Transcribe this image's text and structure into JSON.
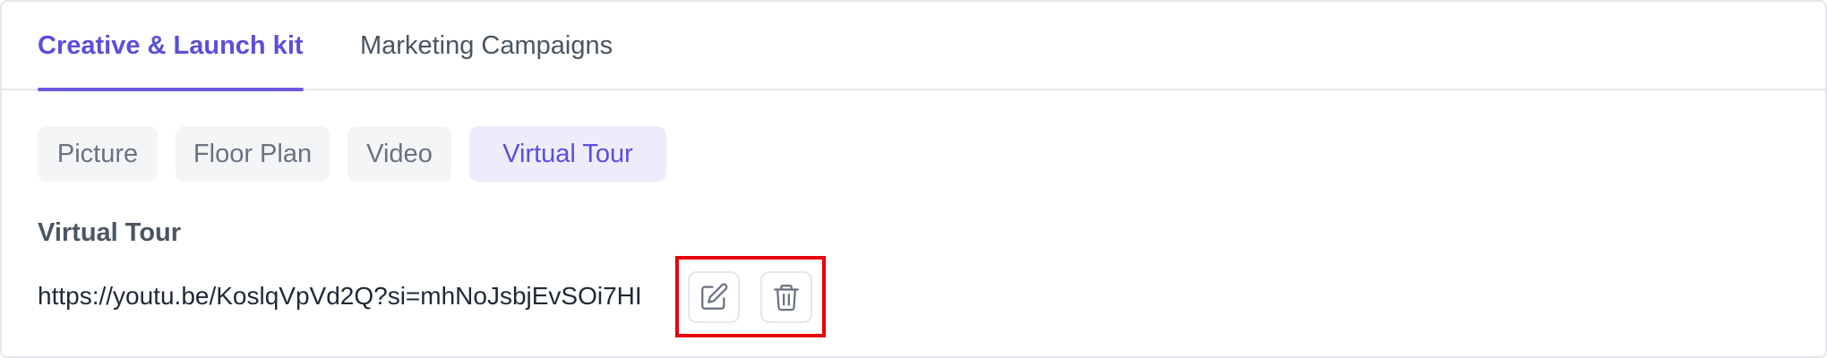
{
  "tabs": [
    {
      "label": "Creative & Launch kit",
      "active": true
    },
    {
      "label": "Marketing Campaigns",
      "active": false
    }
  ],
  "media_types": [
    {
      "label": "Picture",
      "active": false
    },
    {
      "label": "Floor Plan",
      "active": false
    },
    {
      "label": "Video",
      "active": false
    },
    {
      "label": "Virtual Tour",
      "active": true
    }
  ],
  "section": {
    "title": "Virtual Tour",
    "url": "https://youtu.be/KoslqVpVd2Q?si=mhNoJsbjEvSOi7HI"
  },
  "actions": {
    "edit_icon": "edit-icon",
    "delete_icon": "trash-icon"
  },
  "colors": {
    "accent": "#5b4fd9",
    "highlight": "#e8000b"
  }
}
